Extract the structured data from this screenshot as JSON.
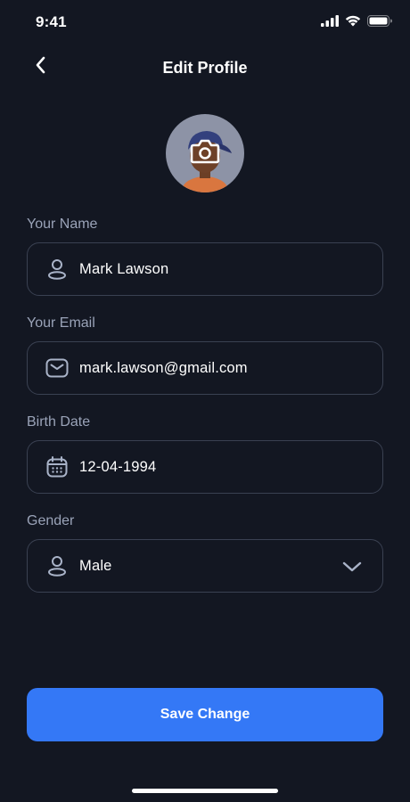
{
  "status_bar": {
    "time": "9:41",
    "icons": [
      "signal-icon",
      "wifi-icon",
      "battery-icon"
    ]
  },
  "header": {
    "title": "Edit Profile",
    "back_icon": "chevron-left-icon"
  },
  "avatar": {
    "camera_icon": "camera-icon"
  },
  "form": {
    "name": {
      "label": "Your Name",
      "value": "Mark Lawson",
      "icon": "user-icon"
    },
    "email": {
      "label": "Your Email",
      "value": "mark.lawson@gmail.com",
      "icon": "mail-icon"
    },
    "birth_date": {
      "label": "Birth Date",
      "value": "12-04-1994",
      "icon": "calendar-icon"
    },
    "gender": {
      "label": "Gender",
      "value": "Male",
      "icon": "user-icon",
      "dropdown_icon": "chevron-down-icon"
    }
  },
  "actions": {
    "save_label": "Save Change"
  },
  "colors": {
    "background": "#131722",
    "accent": "#3478f6",
    "border": "#3a4152",
    "label": "#9aa3b8",
    "icon": "#a9b3c8"
  }
}
